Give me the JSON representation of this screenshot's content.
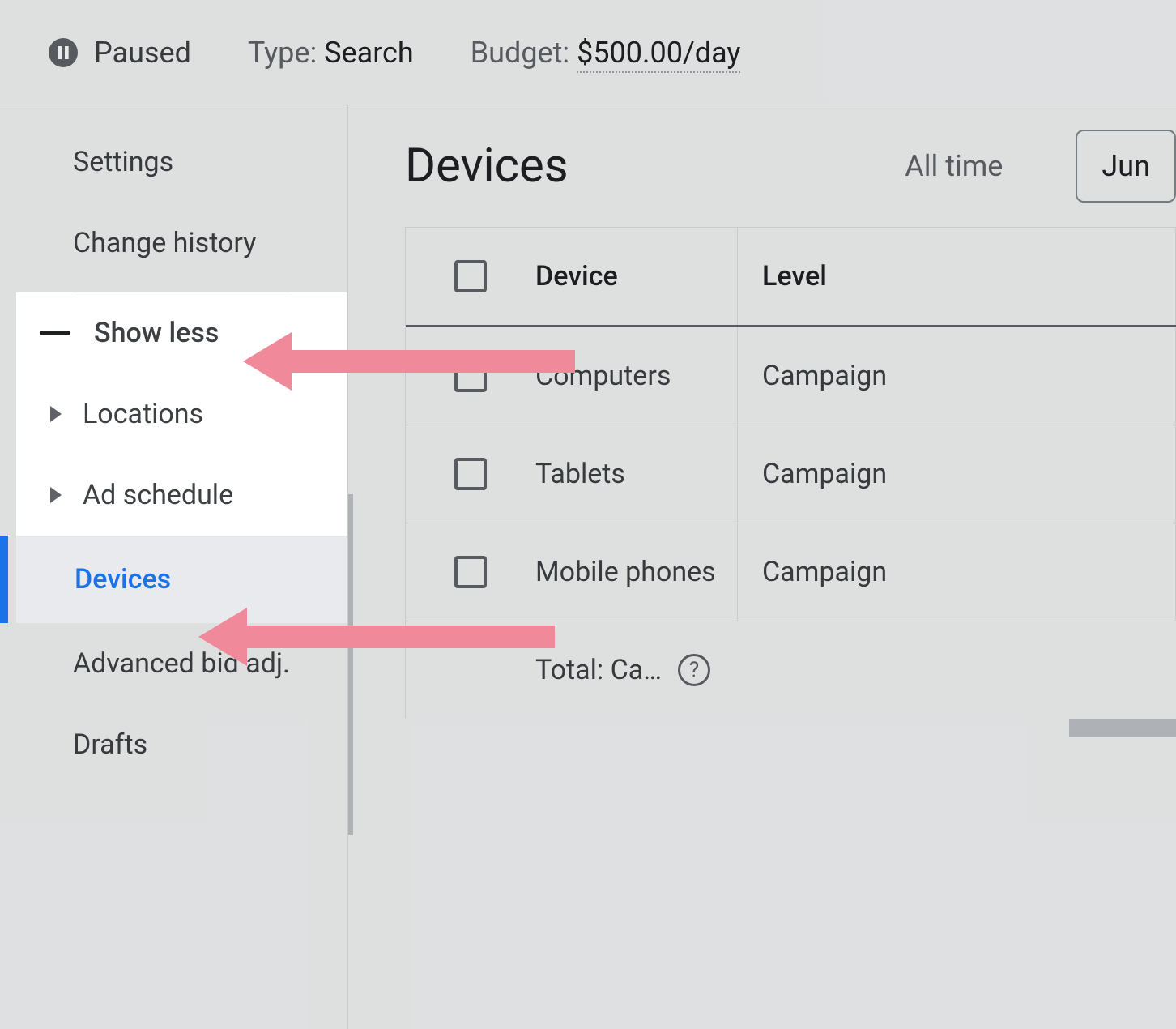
{
  "header": {
    "status": "Paused",
    "type_label": "Type:",
    "type_value": "Search",
    "budget_label": "Budget:",
    "budget_value": "$500.00/day"
  },
  "sidebar": {
    "settings": "Settings",
    "change_history": "Change history",
    "show_less": "Show less",
    "locations": "Locations",
    "ad_schedule": "Ad schedule",
    "devices": "Devices",
    "advanced_bid": "Advanced bid adj.",
    "drafts": "Drafts"
  },
  "main": {
    "title": "Devices",
    "time_range": "All time",
    "date_partial": "Jun",
    "table": {
      "col_device": "Device",
      "col_level": "Level",
      "rows": [
        {
          "device": "Computers",
          "level": "Campaign"
        },
        {
          "device": "Tablets",
          "level": "Campaign"
        },
        {
          "device": "Mobile phones",
          "level": "Campaign"
        }
      ],
      "total_label": "Total: Ca…"
    }
  }
}
